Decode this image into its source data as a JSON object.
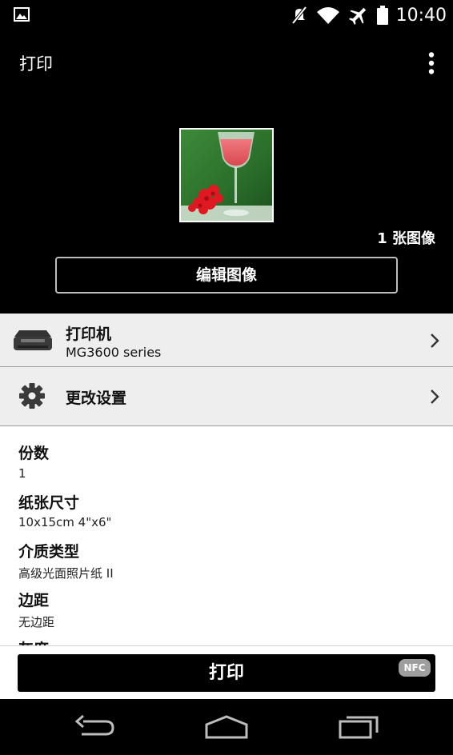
{
  "status_bar": {
    "time": "10:40",
    "icons": [
      "gallery-notification-icon",
      "mute-icon",
      "wifi-icon",
      "airplane-icon",
      "battery-icon"
    ]
  },
  "app_bar": {
    "title": "打印",
    "menu_icon": "overflow-menu-icon"
  },
  "preview": {
    "image_count": "1 张图像",
    "edit_button_label": "编辑图像"
  },
  "printer_row": {
    "icon": "printer-icon",
    "title": "打印机",
    "printer_name": "MG3600 series"
  },
  "settings_row": {
    "icon": "gear-icon",
    "title": "更改设置"
  },
  "settings_list": [
    {
      "label": "份数",
      "value": "1"
    },
    {
      "label": "纸张尺寸",
      "value": "10x15cm 4\"x6\""
    },
    {
      "label": "介质类型",
      "value": "高级光面照片纸 II"
    },
    {
      "label": "边距",
      "value": "无边距"
    },
    {
      "label": "灰度",
      "value": ""
    }
  ],
  "print_button": {
    "label": "打印",
    "nfc_badge": "NFC"
  },
  "nav_bar": {
    "buttons": [
      "back-icon",
      "home-icon",
      "recents-icon"
    ]
  },
  "colors": {
    "background": "#000000",
    "row_background": "#eeeeee",
    "list_background": "#ffffff",
    "nfc_badge": "#9e9e9e"
  }
}
